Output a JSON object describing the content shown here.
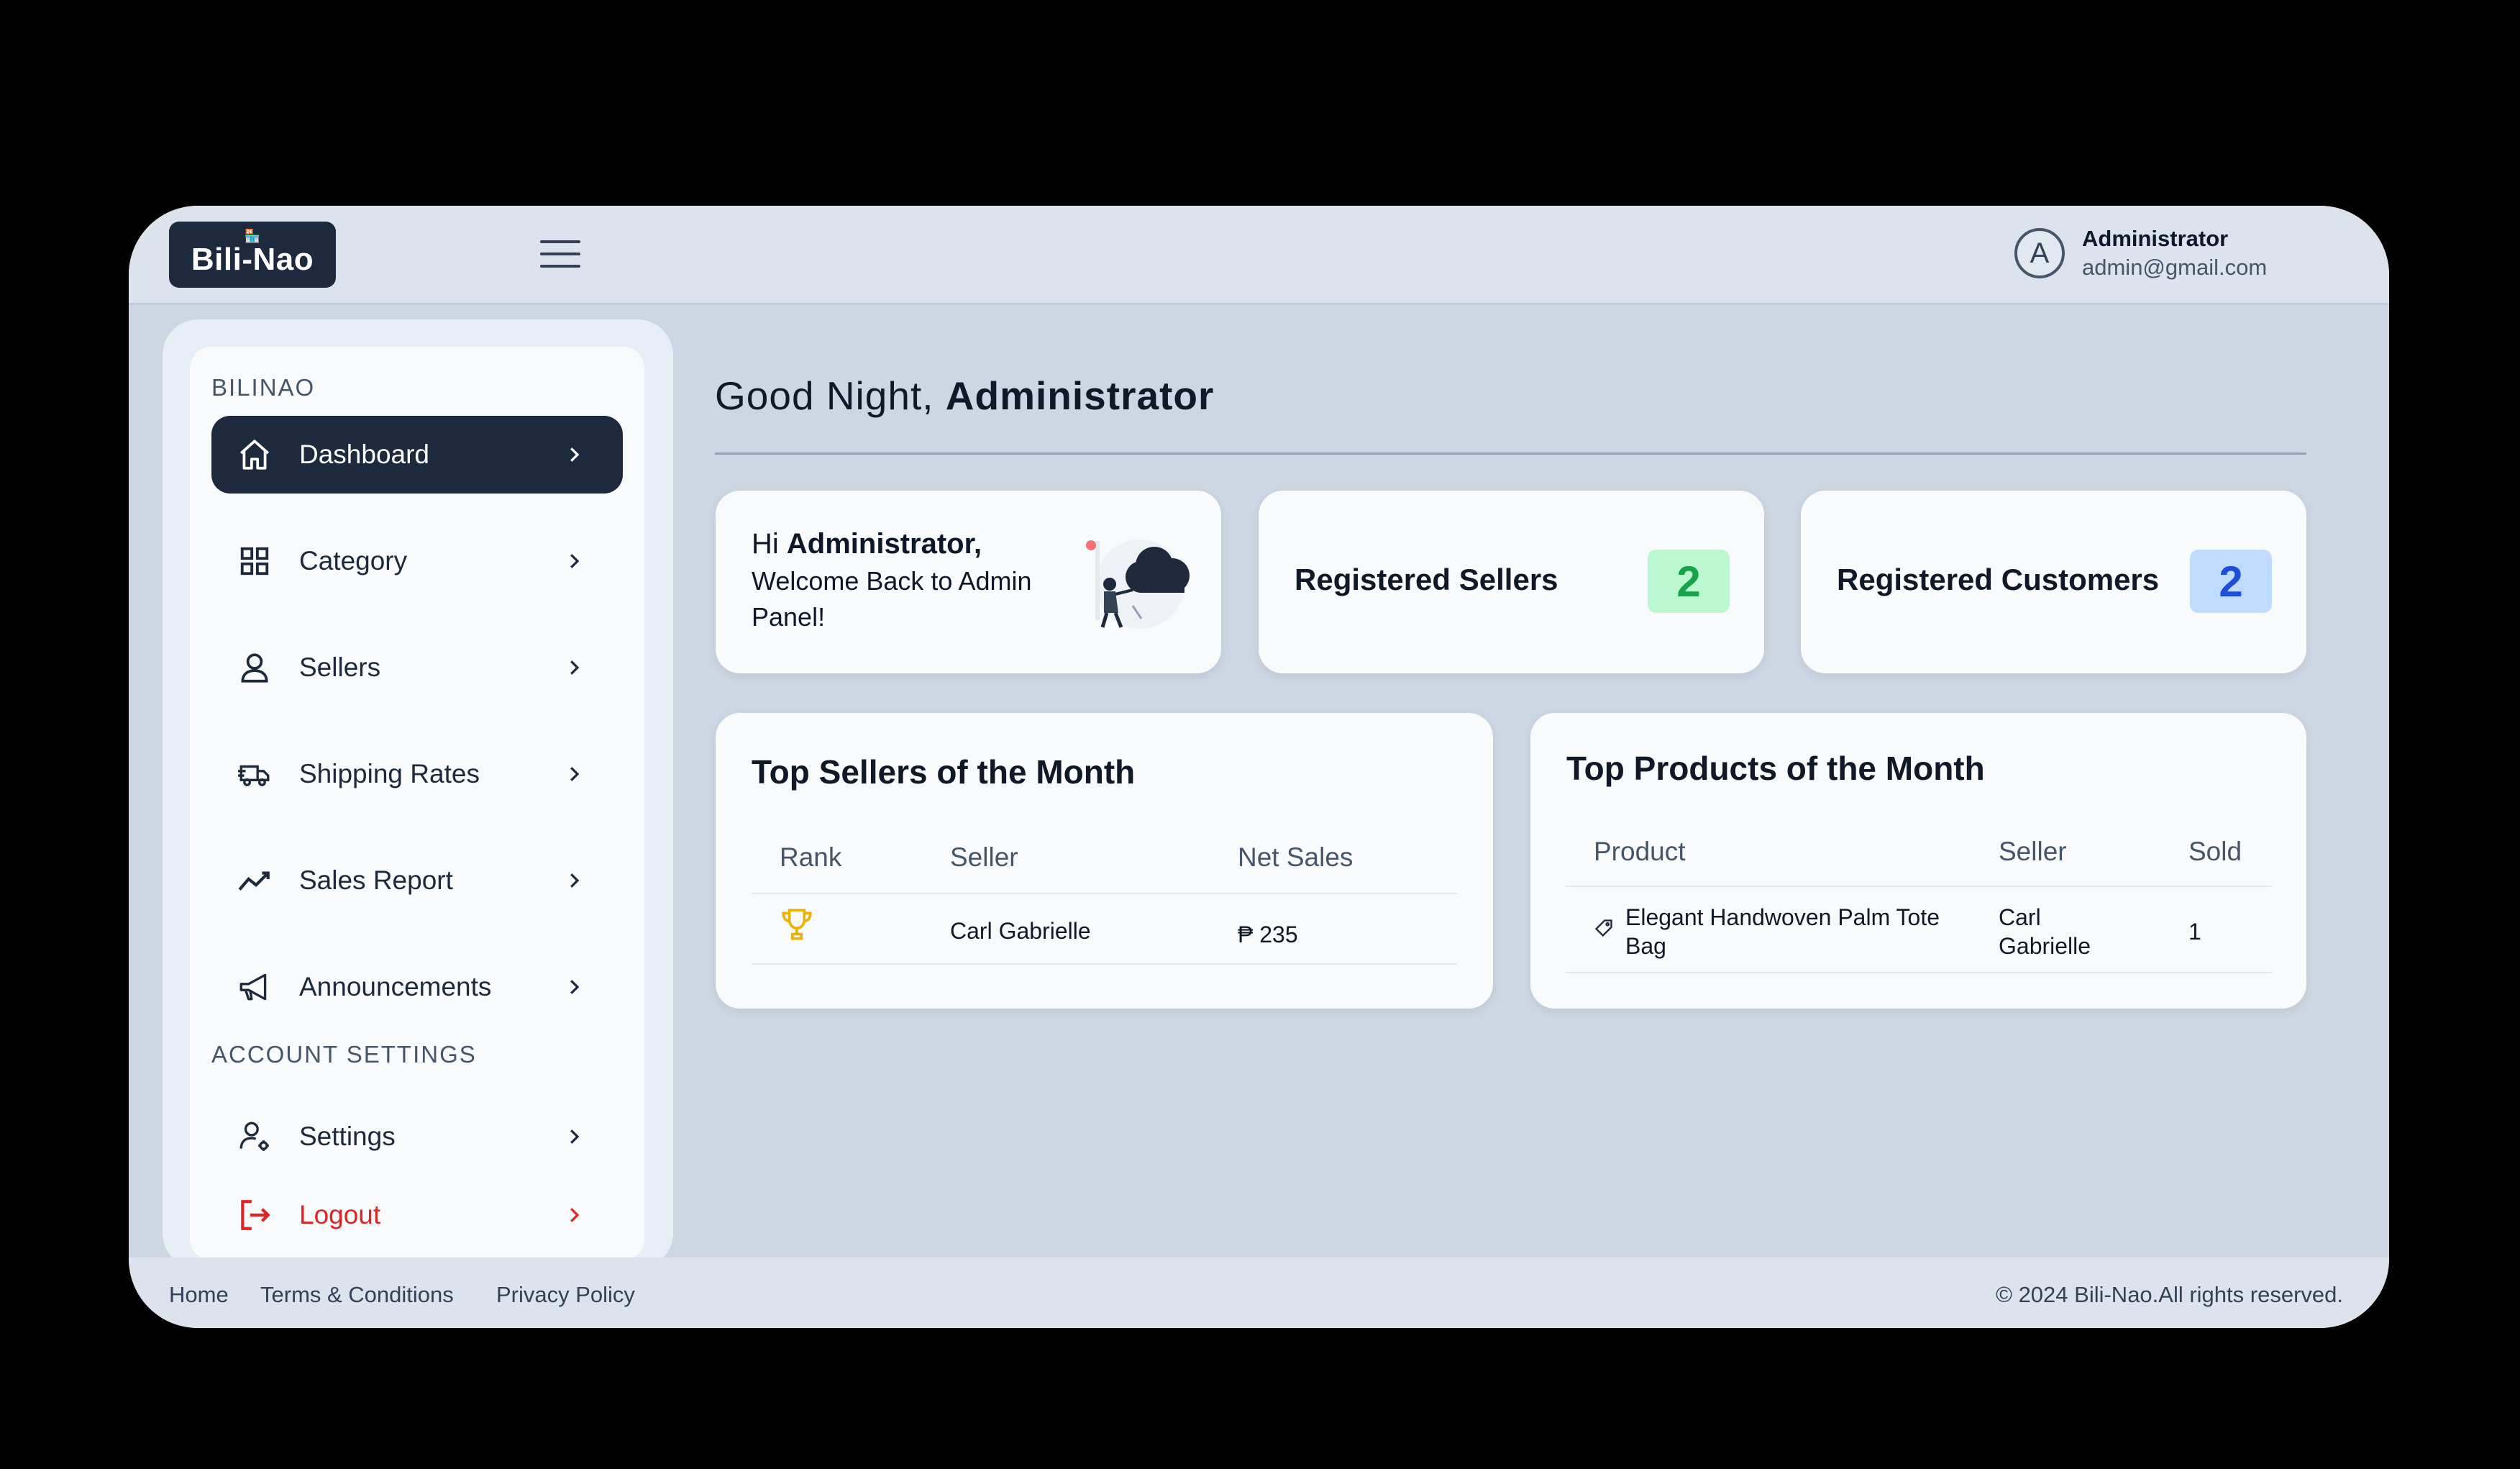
{
  "header": {
    "brand": "Bili-Nao",
    "user_name": "Administrator",
    "user_email": "admin@gmail.com",
    "avatar_letter": "A"
  },
  "sidebar": {
    "section1": "BILINAO",
    "items": [
      {
        "label": "Dashboard",
        "icon": "home-icon"
      },
      {
        "label": "Category",
        "icon": "grid-icon"
      },
      {
        "label": "Sellers",
        "icon": "user-icon"
      },
      {
        "label": "Shipping Rates",
        "icon": "truck-icon"
      },
      {
        "label": "Sales Report",
        "icon": "trend-icon"
      },
      {
        "label": "Announcements",
        "icon": "megaphone-icon"
      }
    ],
    "section2": "ACCOUNT SETTINGS",
    "settings_label": "Settings",
    "logout_label": "Logout"
  },
  "main": {
    "greeting": "Good Night,",
    "greeting_name": "Administrator",
    "welcome_hi": "Hi",
    "welcome_name": "Administrator,",
    "welcome_sub": "Welcome Back to Admin Panel!",
    "sellers_label": "Registered Sellers",
    "sellers_count": "2",
    "customers_label": "Registered Customers",
    "customers_count": "2"
  },
  "top_sellers": {
    "title": "Top Sellers of the Month",
    "headers": [
      "Rank",
      "Seller",
      "Net Sales"
    ],
    "rows": [
      {
        "rank_icon": "trophy-icon",
        "seller": "Carl Gabrielle",
        "net_sales": "₱ 235"
      }
    ]
  },
  "top_products": {
    "title": "Top Products of the Month",
    "headers": [
      "Product",
      "Seller",
      "Sold"
    ],
    "rows": [
      {
        "product": "Elegant Handwoven Palm Tote Bag",
        "seller": "Carl Gabrielle",
        "sold": "1"
      }
    ]
  },
  "footer": {
    "links": [
      "Home",
      "Terms & Conditions",
      "Privacy Policy"
    ],
    "copyright": "© 2024 Bili-Nao.All rights reserved."
  },
  "colors": {
    "accent_dark": "#1d293d",
    "logout_red": "#dc2626",
    "badge_green": "#16a34a",
    "badge_blue": "#1d4ed8"
  }
}
